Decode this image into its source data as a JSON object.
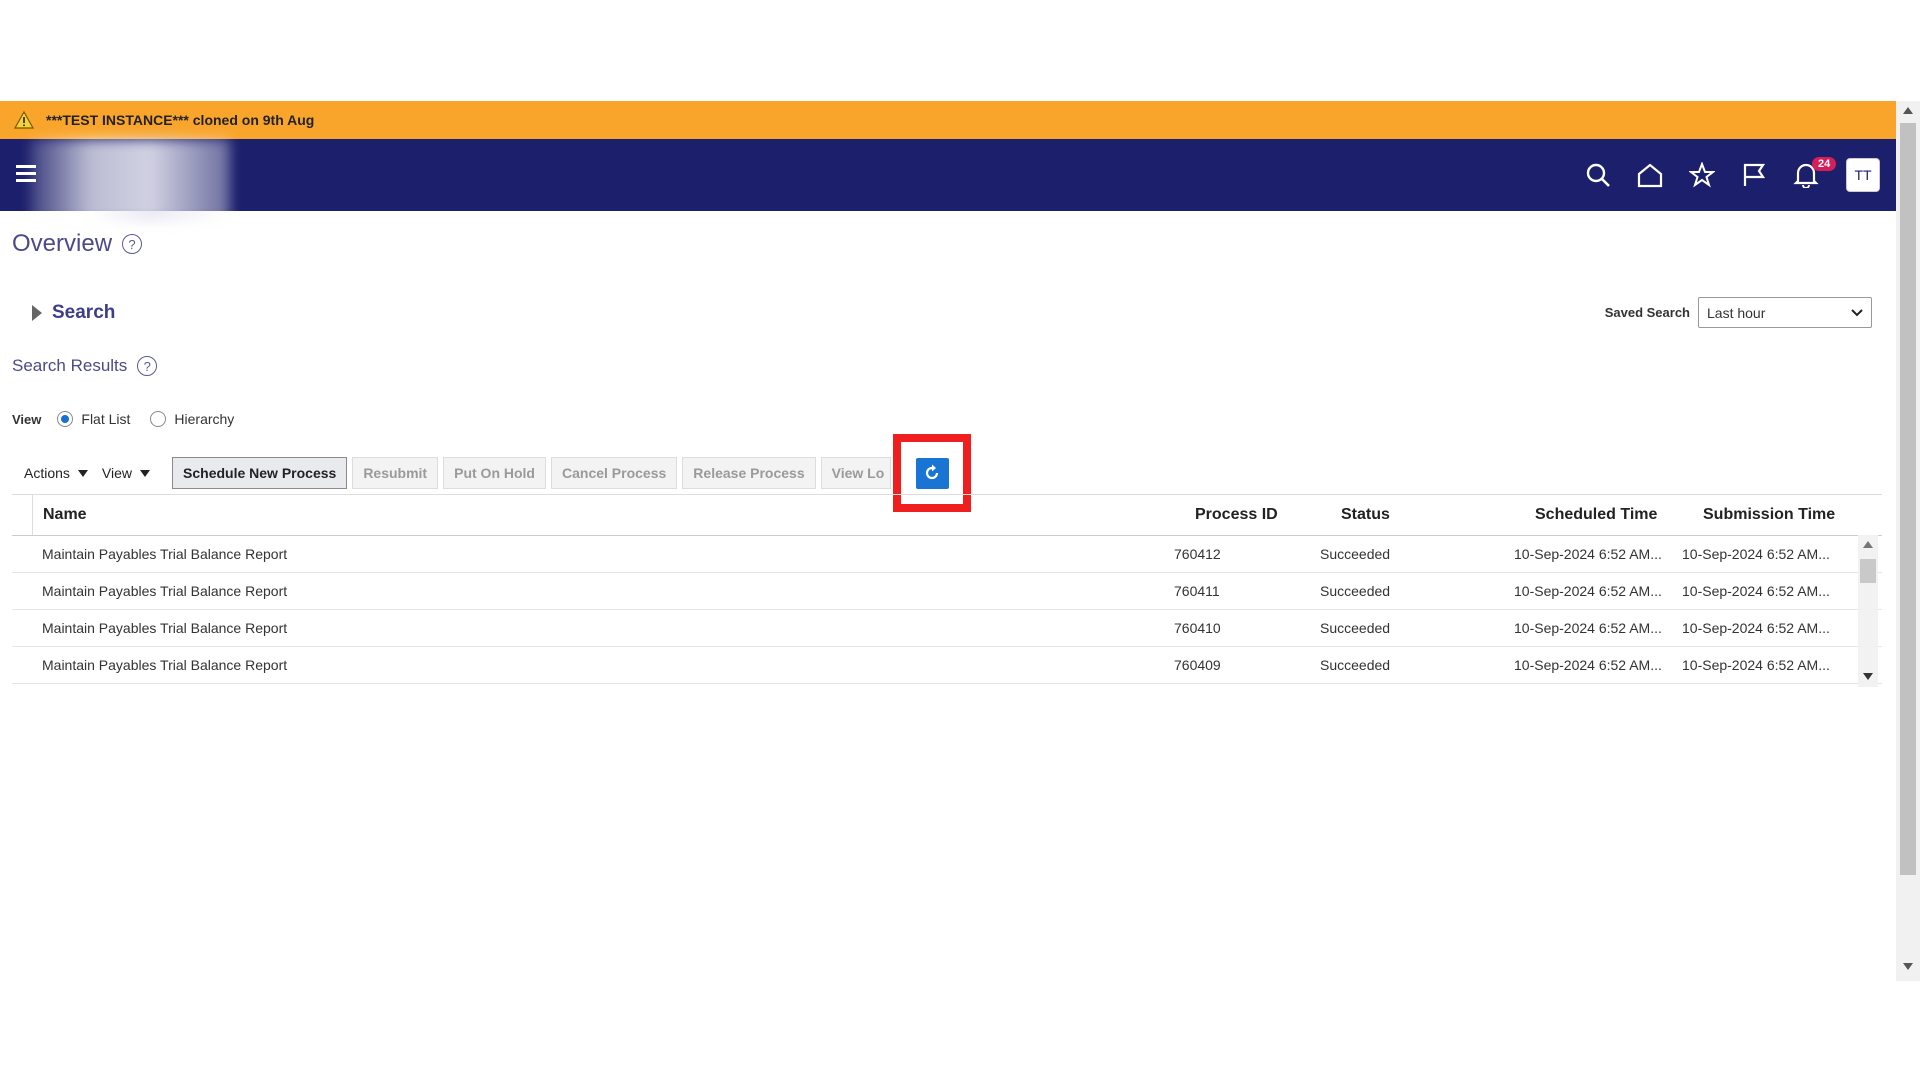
{
  "banner": {
    "text": "***TEST INSTANCE*** cloned on 9th Aug",
    "color": "#f9a52c"
  },
  "header": {
    "color": "#1c1f6b",
    "notifications_count": "24",
    "avatar_initials": "TT",
    "icons": [
      "search-icon",
      "home-icon",
      "star-icon",
      "flag-icon",
      "bell-icon"
    ]
  },
  "page": {
    "title": "Overview"
  },
  "search": {
    "label": "Search"
  },
  "saved_search": {
    "label": "Saved Search",
    "value": "Last hour"
  },
  "results": {
    "title": "Search Results"
  },
  "view": {
    "label": "View",
    "options": [
      "Flat List",
      "Hierarchy"
    ],
    "selected": "Flat List"
  },
  "toolbar": {
    "actions": "Actions",
    "view": "View",
    "schedule": "Schedule New Process",
    "resubmit": "Resubmit",
    "hold": "Put On Hold",
    "cancel": "Cancel Process",
    "release": "Release Process",
    "viewlog": "View Lo",
    "refresh_icon": "refresh-icon"
  },
  "table": {
    "headers": {
      "name": "Name",
      "pid": "Process ID",
      "status": "Status",
      "sched": "Scheduled Time",
      "sub": "Submission Time"
    },
    "rows": [
      {
        "name": "Maintain Payables Trial Balance Report",
        "pid": "760412",
        "status": "Succeeded",
        "sched": "10-Sep-2024 6:52 AM...",
        "sub": "10-Sep-2024 6:52 AM..."
      },
      {
        "name": "Maintain Payables Trial Balance Report",
        "pid": "760411",
        "status": "Succeeded",
        "sched": "10-Sep-2024 6:52 AM...",
        "sub": "10-Sep-2024 6:52 AM..."
      },
      {
        "name": "Maintain Payables Trial Balance Report",
        "pid": "760410",
        "status": "Succeeded",
        "sched": "10-Sep-2024 6:52 AM...",
        "sub": "10-Sep-2024 6:52 AM..."
      },
      {
        "name": "Maintain Payables Trial Balance Report",
        "pid": "760409",
        "status": "Succeeded",
        "sched": "10-Sep-2024 6:52 AM...",
        "sub": "10-Sep-2024 6:52 AM..."
      }
    ]
  }
}
